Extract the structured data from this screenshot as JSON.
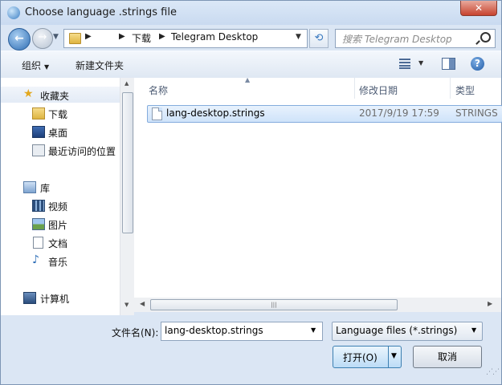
{
  "window": {
    "title": "Choose language .strings file",
    "close_glyph": "✕"
  },
  "navigation": {
    "back_glyph": "←",
    "forward_glyph": "→",
    "breadcrumbs": [
      "下载",
      "Telegram Desktop"
    ],
    "search_placeholder": "搜索 Telegram Desktop"
  },
  "toolbar": {
    "organize": "组织",
    "new_folder": "新建文件夹",
    "help": "?"
  },
  "sidebar": {
    "favorites": "收藏夹",
    "favorites_items": [
      "下载",
      "桌面",
      "最近访问的位置"
    ],
    "libraries": "库",
    "libraries_items": [
      "视频",
      "图片",
      "文档",
      "音乐"
    ],
    "computer": "计算机"
  },
  "files": {
    "columns": [
      "名称",
      "修改日期",
      "类型"
    ],
    "rows": [
      {
        "name": "lang-desktop.strings",
        "modified": "2017/9/19 17:59",
        "type": "STRINGS"
      }
    ]
  },
  "footer": {
    "filename_label": "文件名(N):",
    "filename_value": "lang-desktop.strings",
    "filetype_value": "Language files (*.strings)",
    "open_label": "打开(O)",
    "cancel_label": "取消"
  },
  "colors": {
    "accent": "#3c7fb1",
    "selection": "#cfe3fa"
  }
}
